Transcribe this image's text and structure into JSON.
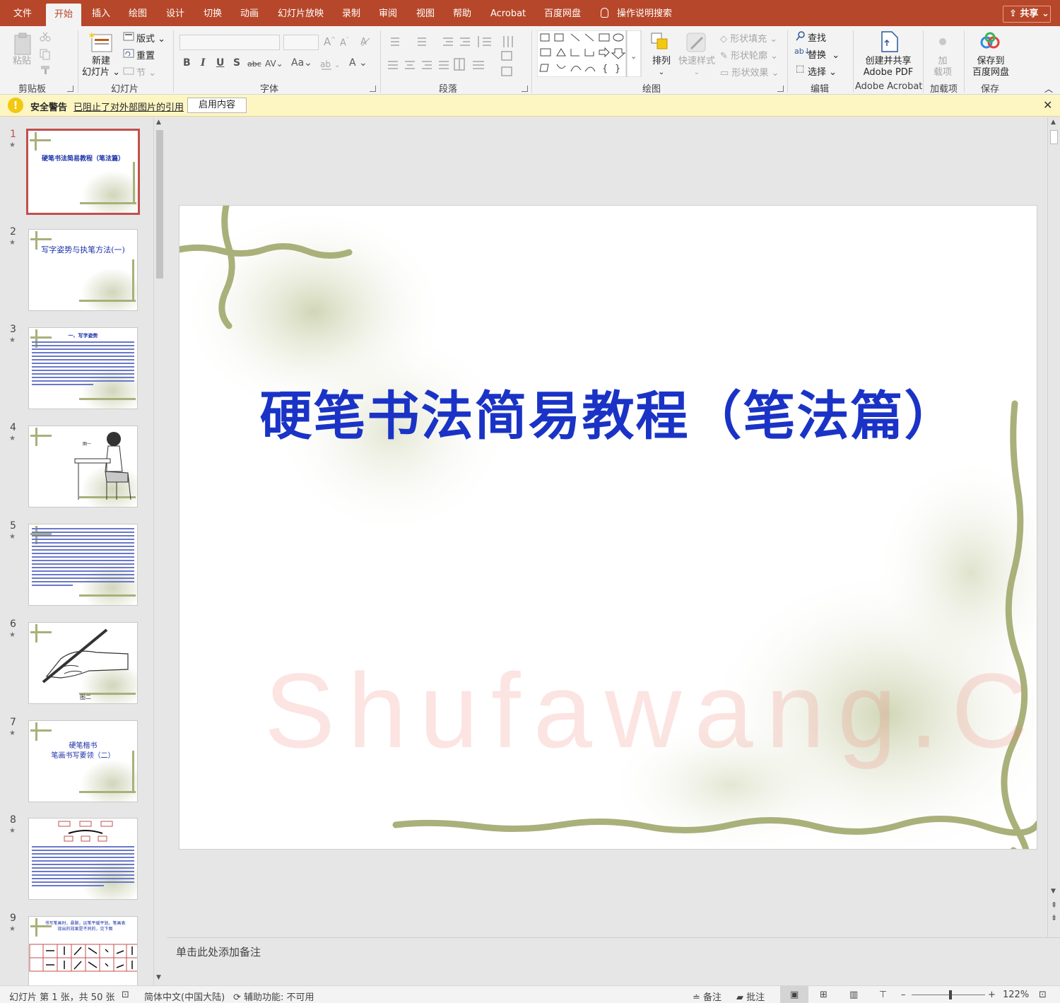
{
  "tabs": [
    {
      "label": "文件",
      "active": false
    },
    {
      "label": "开始",
      "active": true
    },
    {
      "label": "插入",
      "active": false
    },
    {
      "label": "绘图",
      "active": false
    },
    {
      "label": "设计",
      "active": false
    },
    {
      "label": "切换",
      "active": false
    },
    {
      "label": "动画",
      "active": false
    },
    {
      "label": "幻灯片放映",
      "active": false
    },
    {
      "label": "录制",
      "active": false
    },
    {
      "label": "审阅",
      "active": false
    },
    {
      "label": "视图",
      "active": false
    },
    {
      "label": "帮助",
      "active": false
    },
    {
      "label": "Acrobat",
      "active": false
    },
    {
      "label": "百度网盘",
      "active": false
    }
  ],
  "tellme": "操作说明搜索",
  "share_label": "共享",
  "ribbon": {
    "clipboard": {
      "paste": "粘贴",
      "label": "剪贴板"
    },
    "slides": {
      "new_slide_1": "新建",
      "new_slide_2": "幻灯片",
      "layout": "版式",
      "reset": "重置",
      "section": "节",
      "label": "幻灯片"
    },
    "font": {
      "bold": "B",
      "italic": "I",
      "underline": "U",
      "shadow": "S",
      "strike": "abc",
      "spacing": "AV",
      "case": "Aa",
      "color": "A",
      "label": "字体"
    },
    "paragraph": {
      "label": "段落"
    },
    "drawing": {
      "arrange": "排列",
      "quick_styles": "快速样式",
      "shape_fill": "形状填充",
      "shape_outline": "形状轮廓",
      "shape_effects": "形状效果",
      "label": "绘图"
    },
    "editing": {
      "find": "查找",
      "replace": "替换",
      "select": "选择",
      "label": "编辑"
    },
    "acrobat": {
      "line1": "创建并共享",
      "line2": "Adobe PDF",
      "label": "Adobe Acrobat"
    },
    "addins": {
      "line1": "加",
      "line2": "载项",
      "label": "加载项"
    },
    "save": {
      "line1": "保存到",
      "line2": "百度网盘",
      "label": "保存"
    }
  },
  "message_bar": {
    "title": "安全警告",
    "text": "已阻止了对外部图片的引用",
    "button": "启用内容"
  },
  "thumbnails": [
    {
      "num": "1",
      "title": "硬笔书法简易教程（笔法篇）"
    },
    {
      "num": "2",
      "title": "写字姿势与执笔方法(一)"
    },
    {
      "num": "3",
      "title": "一、写字姿势"
    },
    {
      "num": "4",
      "title": "图一"
    },
    {
      "num": "5",
      "title": ""
    },
    {
      "num": "6",
      "title": "图二"
    },
    {
      "num": "7",
      "title": "硬笔楷书",
      "subtitle": "笔画书写要领（二）"
    },
    {
      "num": "8",
      "title": ""
    },
    {
      "num": "9",
      "title": "书写笔画时，悬腕，运笔平缓平划。笔画表现出的效果是不同的，见下图"
    }
  ],
  "slide": {
    "title": "硬笔书法简易教程（笔法篇）",
    "watermark": "Shufawang.CN"
  },
  "notes_placeholder": "单击此处添加备注",
  "status": {
    "slide_info": "幻灯片 第 1 张，共 50 张",
    "language": "简体中文(中国大陆)",
    "accessibility": "辅助功能: 不可用",
    "notes": "备注",
    "comments": "批注",
    "zoom": "122%"
  },
  "colors": {
    "tab_bar": "#b7472a",
    "title_text": "#1a33c6",
    "selection": "#c0504d"
  }
}
